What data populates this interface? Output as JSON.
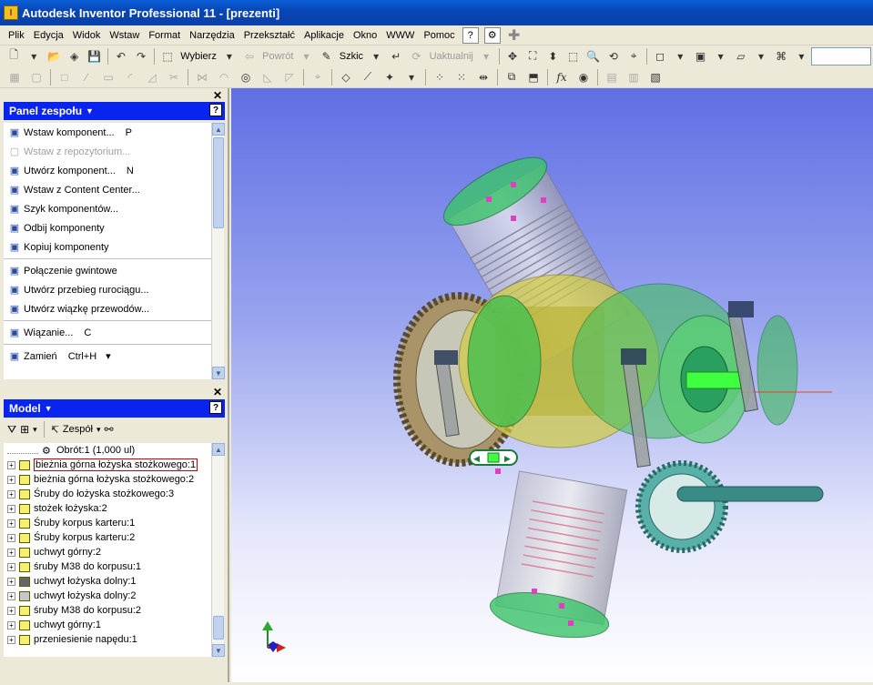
{
  "window": {
    "title": "Autodesk Inventor Professional 11 - [prezenti]"
  },
  "menu": [
    "Plik",
    "Edycja",
    "Widok",
    "Wstaw",
    "Format",
    "Narzędzia",
    "Przekształć",
    "Aplikacje",
    "Okno",
    "WWW",
    "Pomoc"
  ],
  "toolbar": {
    "select_label": "Wybierz",
    "back_label": "Powrót",
    "sketch_label": "Szkic",
    "update_label": "Uaktualnij"
  },
  "assembly_panel": {
    "title": "Panel zespołu",
    "items": [
      {
        "label": "Wstaw komponent...",
        "shortcut": "P",
        "enabled": true,
        "icon": "insert-component-icon"
      },
      {
        "label": "Wstaw z repozytorium...",
        "shortcut": "",
        "enabled": false,
        "icon": "repository-icon"
      },
      {
        "label": "Utwórz komponent...",
        "shortcut": "N",
        "enabled": true,
        "icon": "create-component-icon"
      },
      {
        "label": "Wstaw z Content Center...",
        "shortcut": "",
        "enabled": true,
        "icon": "content-center-icon"
      },
      {
        "label": "Szyk komponentów...",
        "shortcut": "",
        "enabled": true,
        "icon": "pattern-icon"
      },
      {
        "label": "Odbij komponenty",
        "shortcut": "",
        "enabled": true,
        "icon": "mirror-icon"
      },
      {
        "label": "Kopiuj komponenty",
        "shortcut": "",
        "enabled": true,
        "icon": "copy-icon"
      },
      {
        "label": "Połączenie gwintowe",
        "shortcut": "",
        "enabled": true,
        "icon": "bolted-connection-icon"
      },
      {
        "label": "Utwórz przebieg rurociągu...",
        "shortcut": "",
        "enabled": true,
        "icon": "tube-pipe-icon"
      },
      {
        "label": "Utwórz wiązkę przewodów...",
        "shortcut": "",
        "enabled": true,
        "icon": "harness-icon"
      },
      {
        "label": "Wiązanie...",
        "shortcut": "C",
        "enabled": true,
        "icon": "constraint-icon"
      },
      {
        "label": "Zamień",
        "shortcut": "Ctrl+H",
        "enabled": true,
        "icon": "replace-icon"
      }
    ]
  },
  "model_panel": {
    "title": "Model",
    "toolbar_label": "Zespół",
    "top_item": "Obrót:1 (1,000 ul)",
    "tree": [
      {
        "label": "bieżnia górna łożyska stożkowego:1",
        "selected": true,
        "style": "y"
      },
      {
        "label": "bieżnia górna łożyska stożkowego:2",
        "selected": false,
        "style": "y"
      },
      {
        "label": "Śruby do łożyska stożkowego:3",
        "selected": false,
        "style": "y"
      },
      {
        "label": "stożek łożyska:2",
        "selected": false,
        "style": "y"
      },
      {
        "label": "Śruby korpus karteru:1",
        "selected": false,
        "style": "y"
      },
      {
        "label": "Śruby korpus karteru:2",
        "selected": false,
        "style": "y"
      },
      {
        "label": "uchwyt górny:2",
        "selected": false,
        "style": "y"
      },
      {
        "label": "śruby M38 do korpusu:1",
        "selected": false,
        "style": "y"
      },
      {
        "label": "uchwyt łożyska dolny:1",
        "selected": false,
        "style": "d"
      },
      {
        "label": "uchwyt łożyska dolny:2",
        "selected": false,
        "style": "g"
      },
      {
        "label": "śruby M38 do korpusu:2",
        "selected": false,
        "style": "y"
      },
      {
        "label": "uchwyt górny:1",
        "selected": false,
        "style": "y"
      },
      {
        "label": "przeniesienie napędu:1",
        "selected": false,
        "style": "y"
      }
    ]
  },
  "colors": {
    "panel_header": "#0a24f0",
    "titlebar": "#0a5fd8"
  }
}
